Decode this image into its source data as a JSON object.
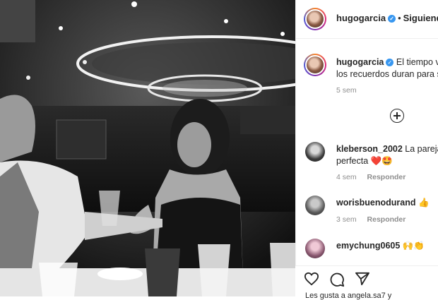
{
  "post": {
    "username": "hugogarcia",
    "follow_separator": "•",
    "follow_label": "Siguiendo",
    "caption_prefix": "El tiempo vu",
    "caption_line2": "los recuerdos duran para si",
    "caption_time": "5 sem"
  },
  "comments": [
    {
      "user": "kleberson_2002",
      "text": "La pareja",
      "text2": "perfecta",
      "emoji": "❤️🤩",
      "time": "4 sem",
      "reply": "Responder"
    },
    {
      "user": "worisbuenodurand",
      "text": "",
      "text2": "",
      "emoji": "👍",
      "time": "3 sem",
      "reply": "Responder"
    },
    {
      "user": "emychung0605",
      "text": "",
      "text2": "",
      "emoji": "🙌👏",
      "time": "",
      "reply": ""
    }
  ],
  "footer": {
    "likes_text": "Les gusta a angela.sa7 y"
  },
  "colors": {
    "accent": "#3897f0",
    "text": "#262626",
    "muted": "#8e8e8e"
  }
}
